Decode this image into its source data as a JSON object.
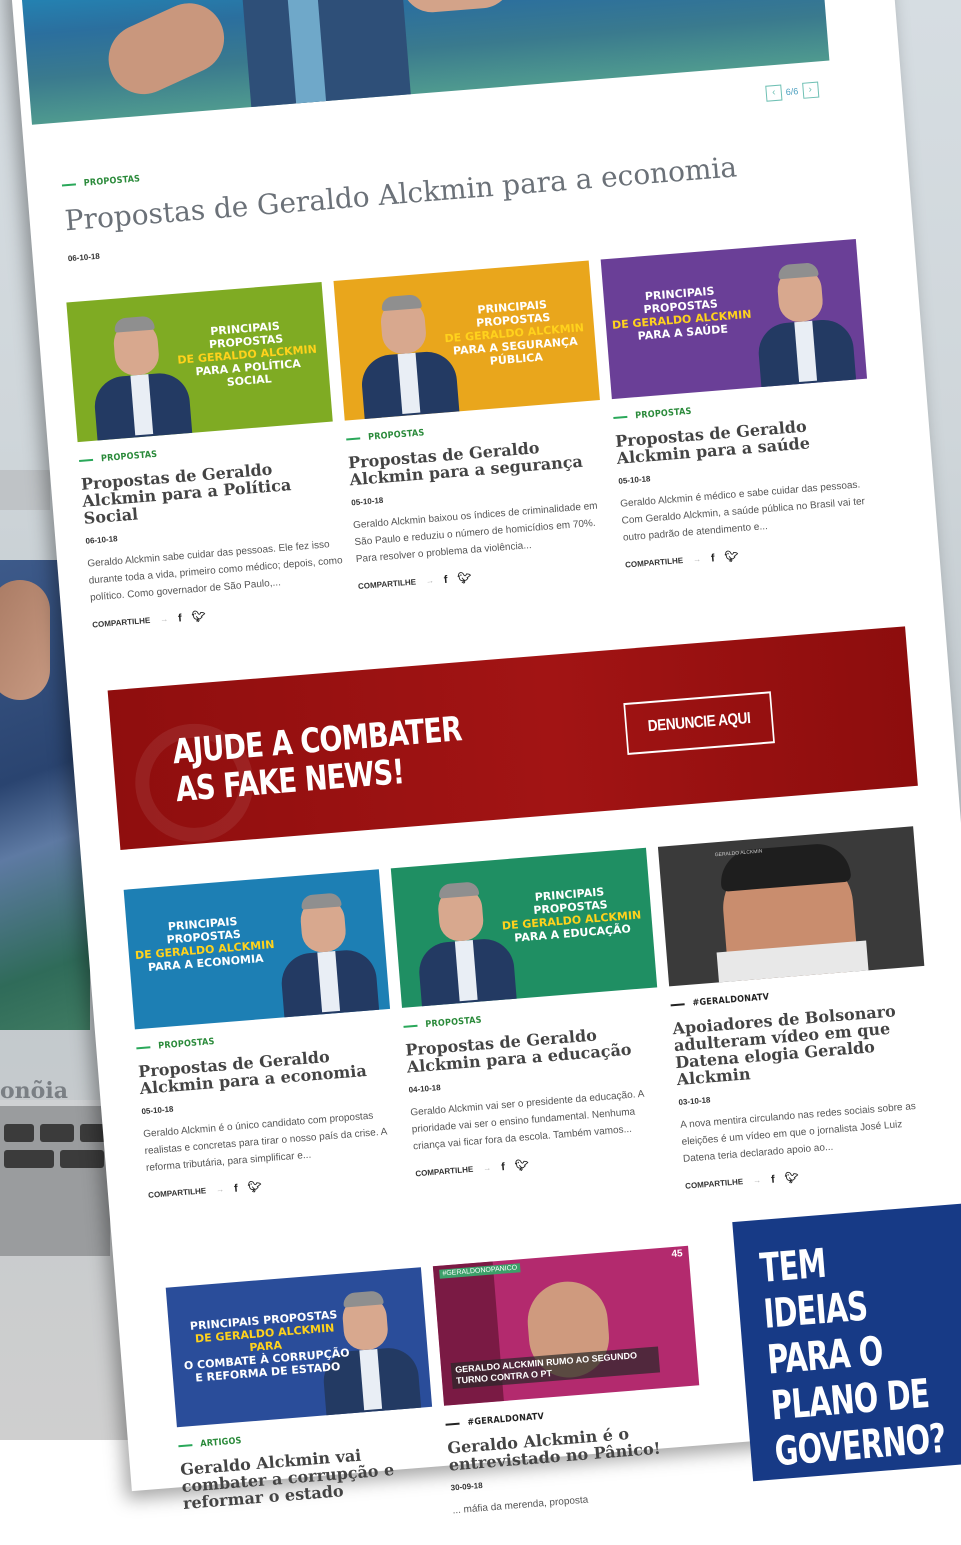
{
  "hero": {
    "pager": "6/6"
  },
  "lead": {
    "tag": "PROPOSTAS",
    "title": "Propostas de Geraldo Alckmin para a economia",
    "date": "06-10-18"
  },
  "cards_row1": [
    {
      "thumb_line1": "PRINCIPAIS PROPOSTAS",
      "thumb_line2": "DE GERALDO ALCKMIN",
      "thumb_line3": "PARA A POLÍTICA SOCIAL",
      "thumb_color": "#7fab23",
      "tag": "PROPOSTAS",
      "title": "Propostas de Geraldo Alckmin para a Política Social",
      "date": "06-10-18",
      "excerpt": "Geraldo Alckmin sabe cuidar das pessoas. Ele fez isso durante toda a vida, primeiro como médico; depois, como político. Como governador de São Paulo,...",
      "share": "COMPARTILHE"
    },
    {
      "thumb_line1": "PRINCIPAIS PROPOSTAS",
      "thumb_line2": "DE GERALDO ALCKMIN",
      "thumb_line3": "PARA A SEGURANÇA PÚBLICA",
      "thumb_color": "#e9a61c",
      "tag": "PROPOSTAS",
      "title": "Propostas de Geraldo Alckmin para a segurança",
      "date": "05-10-18",
      "excerpt": "Geraldo Alckmin baixou os índices de criminalidade em São Paulo e reduziu o número de homicídios em 70%. Para resolver o problema da violência...",
      "share": "COMPARTILHE"
    },
    {
      "thumb_line1": "PRINCIPAIS PROPOSTAS",
      "thumb_line2": "DE GERALDO ALCKMIN",
      "thumb_line3": "PARA A SAÚDE",
      "thumb_color": "#6a3f97",
      "tag": "PROPOSTAS",
      "title": "Propostas de Geraldo Alckmin para a saúde",
      "date": "05-10-18",
      "excerpt": "Geraldo Alckmin é médico e sabe cuidar das pessoas. Com Geraldo Alckmin, a saúde pública no Brasil vai ter outro padrão de atendimento e...",
      "share": "COMPARTILHE"
    }
  ],
  "banner": {
    "line1": "AJUDE A COMBATER",
    "line2": "AS FAKE NEWS!",
    "button": "DENUNCIE AQUI",
    "color": "#9b1212"
  },
  "cards_row2": [
    {
      "thumb_line1": "PRINCIPAIS PROPOSTAS",
      "thumb_line2": "DE GERALDO ALCKMIN",
      "thumb_line3": "PARA A ECONOMIA",
      "thumb_color": "#1d7fb4",
      "tag": "PROPOSTAS",
      "title": "Propostas de Geraldo Alckmin para a economia",
      "date": "05-10-18",
      "excerpt": "Geraldo Alckmin é o único candidato com propostas realistas e concretas para tirar o nosso país da crise. A reforma tributária, para simplificar e...",
      "share": "COMPARTILHE"
    },
    {
      "thumb_line1": "PRINCIPAIS PROPOSTAS",
      "thumb_line2": "DE GERALDO ALCKMIN",
      "thumb_line3": "PARA A EDUCAÇÃO",
      "thumb_color": "#1f8f63",
      "tag": "PROPOSTAS",
      "title": "Propostas de Geraldo Alckmin para a educação",
      "date": "04-10-18",
      "excerpt": "Geraldo Alckmin vai ser o presidente da educação. A prioridade vai ser o ensino fundamental. Nenhuma criança vai ficar fora da escola. Também vamos...",
      "share": "COMPARTILHE"
    },
    {
      "thumb_caption": "GERALDO ALCKMIN",
      "thumb_color": "#3a3a3a",
      "tag": "#GERALDONATV",
      "title": "Apoiadores de Bolsonaro adulteram vídeo em que Datena elogia Geraldo Alckmin",
      "date": "03-10-18",
      "excerpt": "A nova mentira circulando nas redes sociais sobre as eleições é um vídeo em que o jornalista José Luiz Datena teria declarado apoio ao...",
      "share": "COMPARTILHE"
    }
  ],
  "cards_row3": [
    {
      "thumb_line1": "PRINCIPAIS PROPOSTAS",
      "thumb_line2": "DE GERALDO ALCKMIN PARA",
      "thumb_line3": "O COMBATE À CORRUPÇÃO E REFORMA DE ESTADO",
      "thumb_color": "#2a4d9a",
      "tag": "ARTIGOS",
      "title": "Geraldo Alckmin vai combater a corrupção e reformar o estado"
    },
    {
      "thumb_top": "#GERALDONOPANICO",
      "thumb_badge": "45",
      "thumb_caption": "GERALDO ALCKMIN RUMO AO SEGUNDO TURNO CONTRA O PT",
      "thumb_color": "#b32a6e",
      "tag": "#GERALDONATV",
      "title": "Geraldo Alckmin é o entrevistado no Pânico!",
      "date": "30-09-18",
      "excerpt": "... máfia da merenda, proposta"
    }
  ],
  "promo": {
    "line1": "TEM IDEIAS",
    "line2": "PARA O",
    "line3": "PLANO DE",
    "line4": "GOVERNO?",
    "color": "#173a86"
  },
  "background": {
    "fragment": "onõia"
  }
}
